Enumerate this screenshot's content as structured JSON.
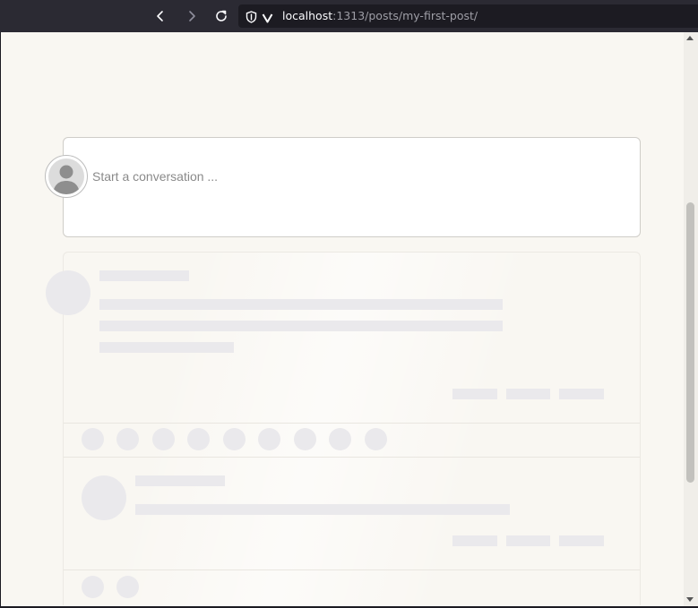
{
  "browser": {
    "url_host": "localhost",
    "url_rest": ":1313/posts/my-first-post/",
    "back_icon": "chevron-left-icon",
    "forward_icon": "chevron-right-icon",
    "reload_icon": "reload-icon",
    "shield_icon": "tracking-protection-shield-icon",
    "site_icon": "site-identity-icon"
  },
  "comments": {
    "composer_placeholder": "Start a conversation ...",
    "avatar_icon": "default-user-avatar-icon"
  },
  "colors": {
    "page_background": "#f9f7f2",
    "toolbar_background": "#2b2a33",
    "skeleton": "#eae9ec"
  }
}
